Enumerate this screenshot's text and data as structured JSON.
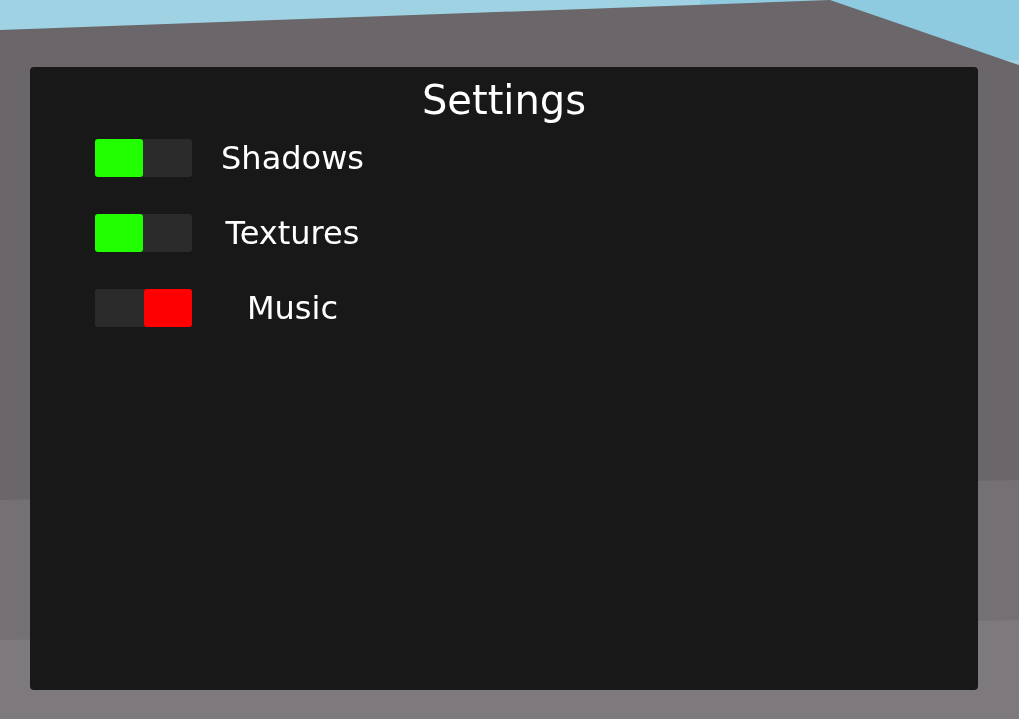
{
  "panel": {
    "title": "Settings"
  },
  "settings": [
    {
      "label": "Shadows",
      "on": true
    },
    {
      "label": "Textures",
      "on": true
    },
    {
      "label": "Music",
      "on": false
    }
  ]
}
